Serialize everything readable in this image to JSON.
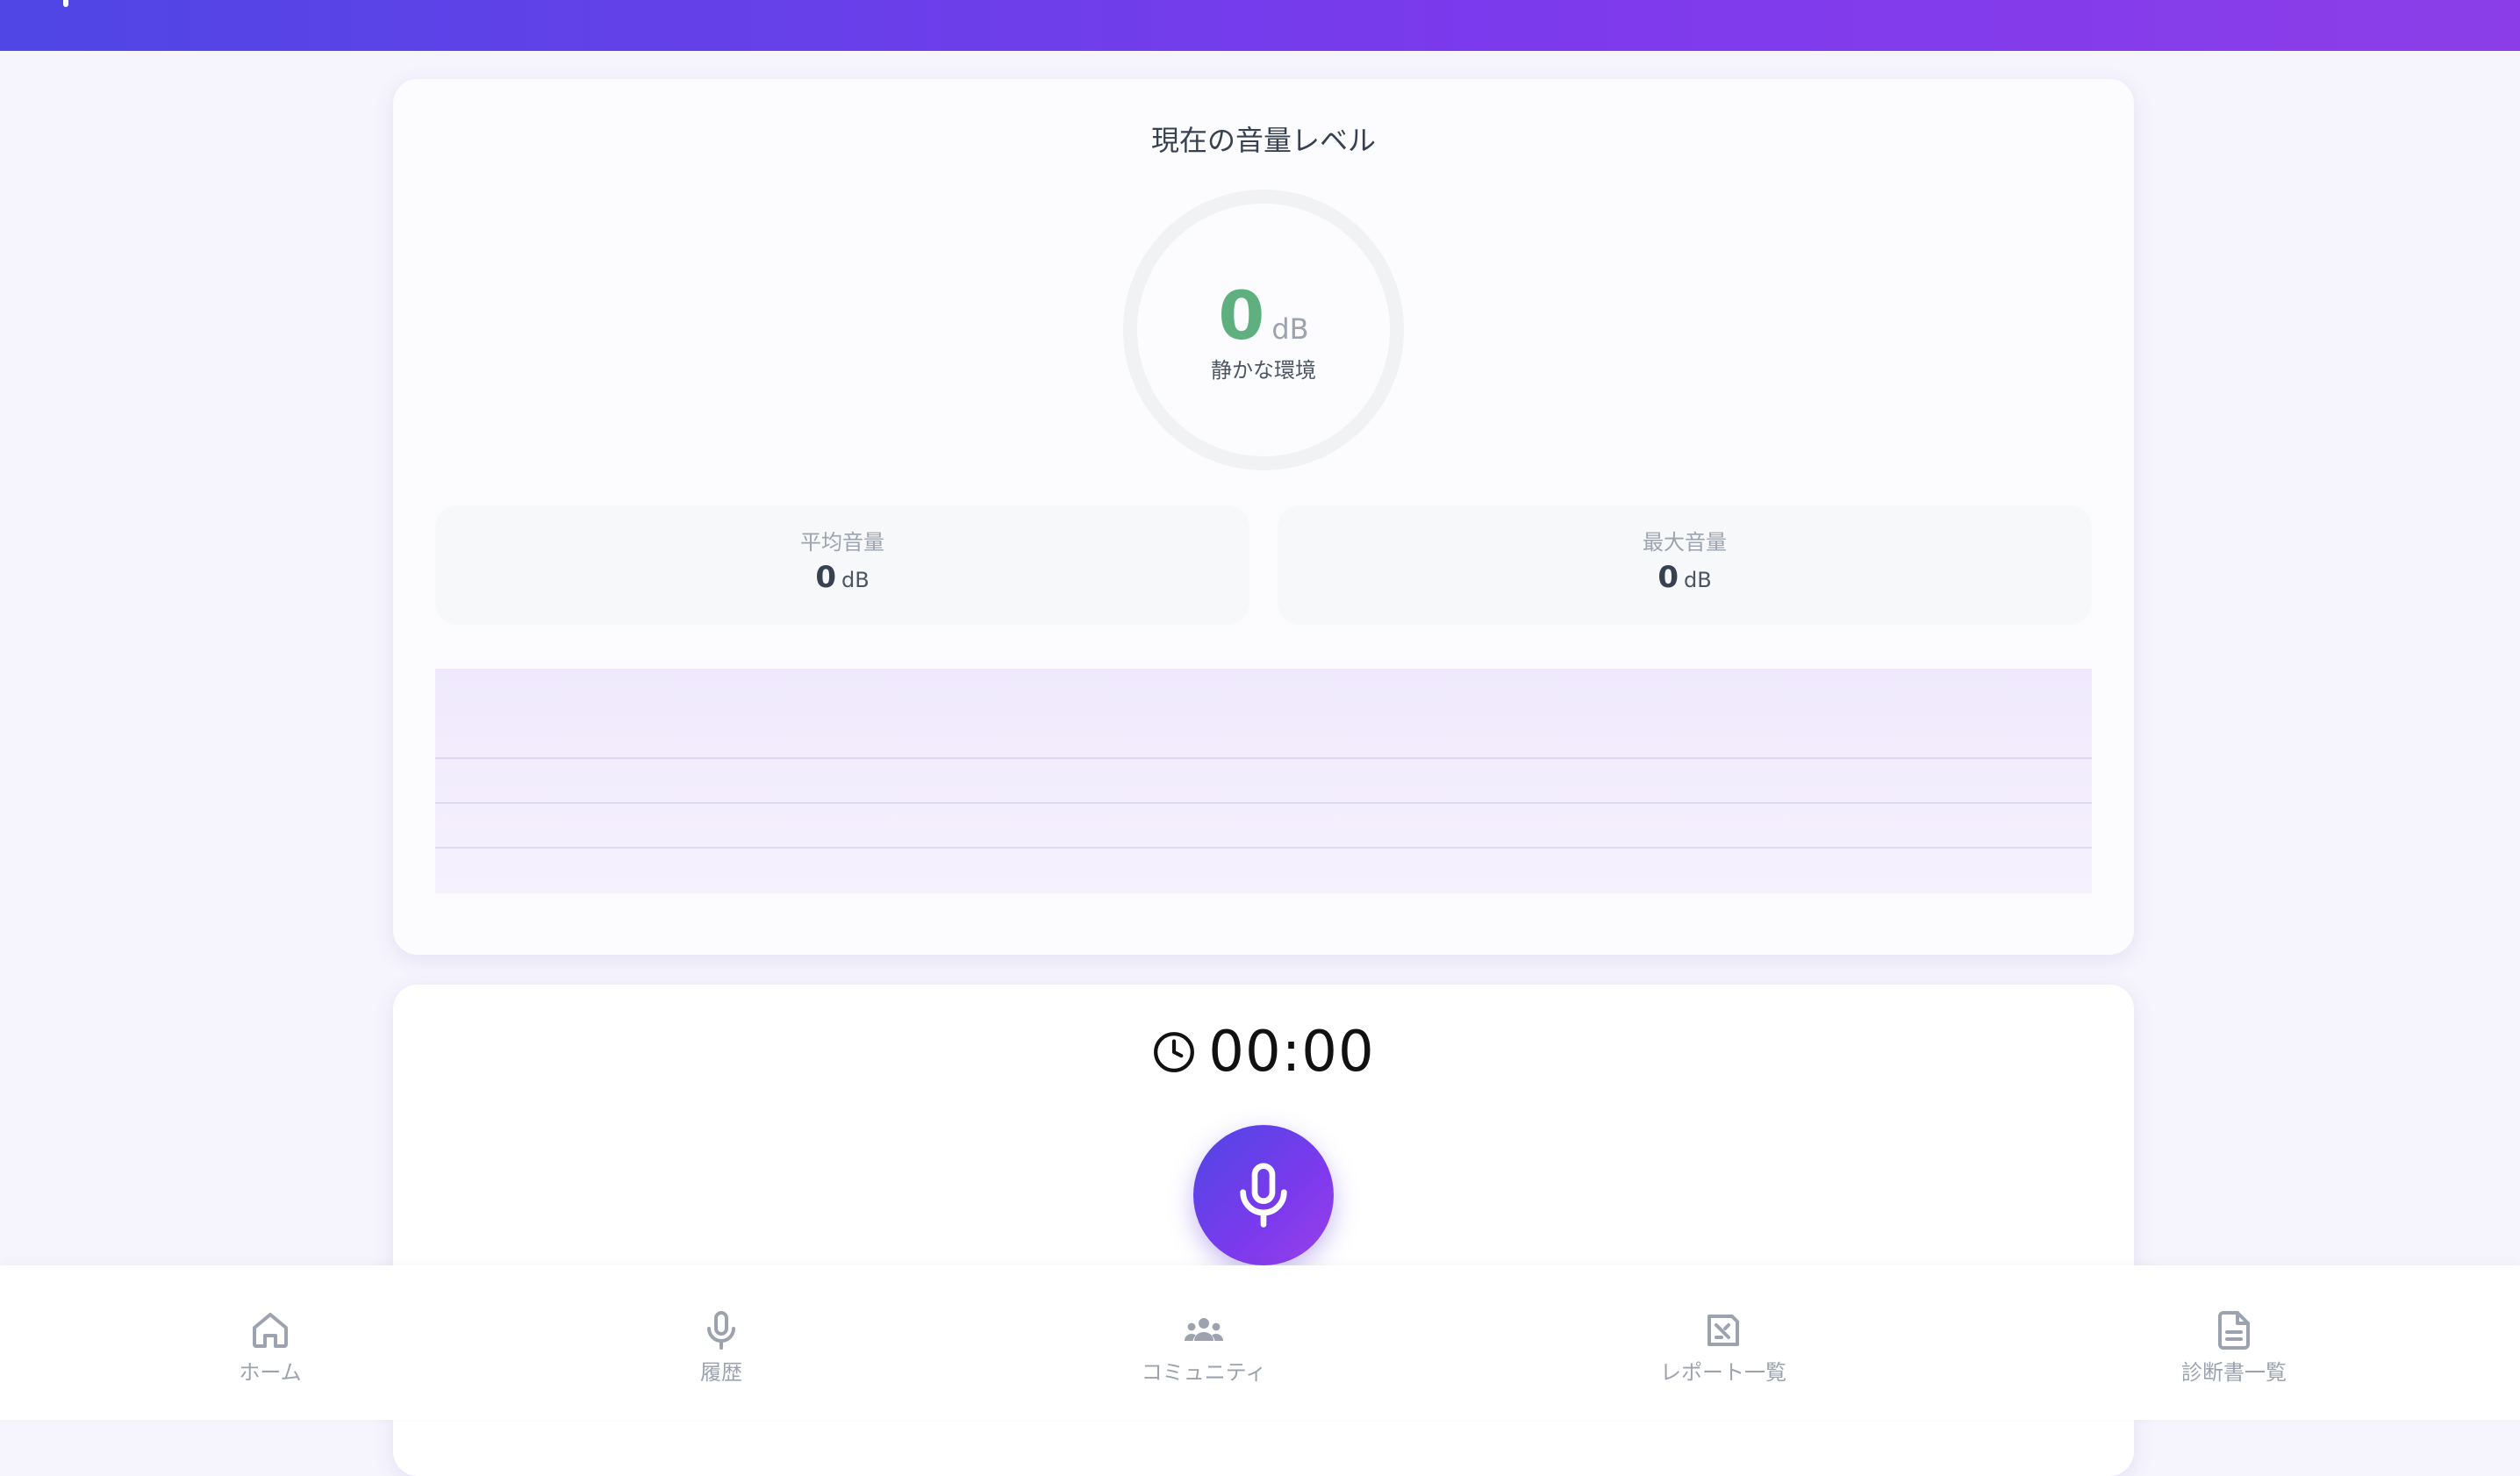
{
  "level_card": {
    "title": "現在の音量レベル",
    "gauge": {
      "value": "0",
      "unit": "dB",
      "status": "静かな環境",
      "value_color": "#5fb07f"
    },
    "stats": {
      "average": {
        "label": "平均音量",
        "value": "0",
        "unit": "dB"
      },
      "maximum": {
        "label": "最大音量",
        "value": "0",
        "unit": "dB"
      }
    }
  },
  "record_card": {
    "timer": "00:00",
    "timer_icon": "clock-icon",
    "record_button_icon": "microphone-icon"
  },
  "bottom_nav": {
    "items": [
      {
        "label": "ホーム",
        "icon": "home-icon"
      },
      {
        "label": "履歴",
        "icon": "microphone-icon"
      },
      {
        "label": "コミュニティ",
        "icon": "users-icon"
      },
      {
        "label": "レポート一覧",
        "icon": "report-icon"
      },
      {
        "label": "診断書一覧",
        "icon": "document-icon"
      }
    ]
  },
  "colors": {
    "accent_start": "#4f46e5",
    "accent_end": "#8b3ee8",
    "background": "#f6f4fd",
    "nav_inactive": "#9ca3af"
  }
}
